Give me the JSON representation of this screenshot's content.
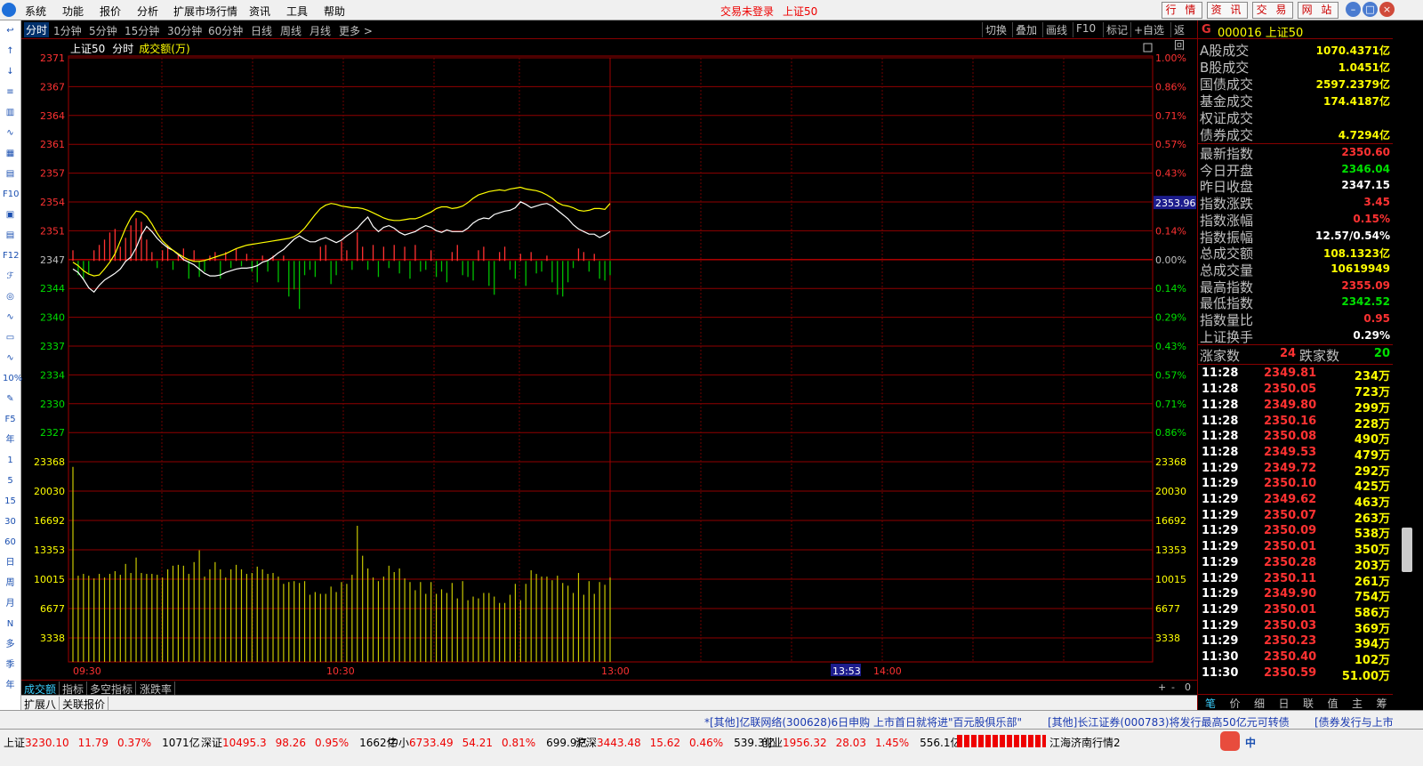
{
  "menu": {
    "items": [
      "系统",
      "功能",
      "报价",
      "分析",
      "扩展市场行情",
      "资讯",
      "工具",
      "帮助"
    ],
    "login_status": "交易未登录",
    "index_name": "上证50"
  },
  "top_buttons": [
    "行 情",
    "资 讯",
    "交 易",
    "网 站"
  ],
  "period_tabs": {
    "items": [
      "分时",
      "1分钟",
      "5分钟",
      "15分钟",
      "30分钟",
      "60分钟",
      "日线",
      "周线",
      "月线",
      "更多 >"
    ],
    "active": "分时"
  },
  "right_tools": [
    "切换",
    "叠加",
    "画线",
    "F10",
    "标记",
    "+自选",
    "返回"
  ],
  "chart_header": {
    "name": "上证50",
    "period": "分时",
    "indicator": "成交额(万)"
  },
  "side_tools": [
    "↩",
    "↑",
    "↓",
    "≡",
    "▥",
    "∿",
    "▦",
    "▤",
    "F10",
    "▣",
    "▤",
    "F12",
    "ℱ",
    "◎",
    "∿",
    "▭",
    "∿",
    "10%",
    "✎",
    "F5",
    "年",
    "1",
    "5",
    "15",
    "30",
    "60",
    "日",
    "周",
    "月",
    "N",
    "多",
    "季",
    "年"
  ],
  "chart_data": [
    {
      "type": "line",
      "title": "上证50 分时",
      "time_labels": [
        "09:30",
        "10:30",
        "13:00",
        "13:53",
        "14:00"
      ],
      "yticks_left": [
        2371,
        2367,
        2364,
        2361,
        2357,
        2354,
        2351,
        2347,
        2344,
        2340,
        2337,
        2334,
        2330,
        2327
      ],
      "yticks_right": [
        "1.00%",
        "0.86%",
        "0.71%",
        "0.57%",
        "0.43%",
        "0.29%",
        "0.14%",
        "0.00%",
        "0.14%",
        "0.29%",
        "0.43%",
        "0.57%",
        "0.71%",
        "0.86%"
      ],
      "prev_close": 2347.15,
      "ylim": [
        2327,
        2371
      ],
      "current_label": "2353.96",
      "series": [
        {
          "name": "price",
          "color": "#ffffff",
          "values": [
            2346.2,
            2345.8,
            2345.0,
            2344.0,
            2343.5,
            2344.3,
            2344.9,
            2345.3,
            2345.7,
            2346.2,
            2347.1,
            2347.6,
            2348.7,
            2350.2,
            2351.2,
            2350.6,
            2349.8,
            2349.2,
            2348.7,
            2348.4,
            2347.9,
            2347.3,
            2347.0,
            2346.7,
            2346.2,
            2345.7,
            2345.4,
            2345.4,
            2345.5,
            2345.8,
            2346.0,
            2346.2,
            2346.3,
            2346.3,
            2346.4,
            2346.6,
            2347.0,
            2347.2,
            2347.6,
            2348.1,
            2348.5,
            2349.1,
            2349.7,
            2350.1,
            2349.7,
            2349.4,
            2349.4,
            2349.7,
            2349.9,
            2349.6,
            2349.3,
            2349.6,
            2350.1,
            2350.5,
            2351.0,
            2351.7,
            2352.3,
            2351.2,
            2350.6,
            2351.1,
            2351.3,
            2351.0,
            2350.5,
            2350.2,
            2350.4,
            2350.6,
            2351.0,
            2351.3,
            2351.1,
            2350.7,
            2350.5,
            2350.8,
            2350.6,
            2350.6,
            2350.6,
            2351.0,
            2351.6,
            2352.0,
            2352.2,
            2352.1,
            2352.6,
            2352.8,
            2353.0,
            2353.1,
            2353.4,
            2354.1,
            2353.8,
            2353.4,
            2353.6,
            2353.8,
            2353.9,
            2353.6,
            2353.1,
            2352.6,
            2352.1,
            2351.4,
            2350.9,
            2350.6,
            2350.3,
            2350.3,
            2349.9,
            2350.2,
            2350.6
          ]
        },
        {
          "name": "average",
          "color": "#ffff00",
          "values": [
            2347.0,
            2346.6,
            2346.0,
            2345.6,
            2345.4,
            2345.5,
            2346.2,
            2347.0,
            2348.0,
            2349.5,
            2351.0,
            2352.2,
            2353.0,
            2352.9,
            2352.4,
            2351.5,
            2350.4,
            2349.5,
            2348.9,
            2348.4,
            2348.0,
            2347.6,
            2347.3,
            2347.1,
            2347.1,
            2347.2,
            2347.4,
            2347.6,
            2347.8,
            2348.0,
            2348.3,
            2348.6,
            2348.8,
            2349.0,
            2349.1,
            2349.2,
            2349.3,
            2349.4,
            2349.5,
            2349.6,
            2349.7,
            2349.8,
            2350.0,
            2350.4,
            2351.0,
            2351.8,
            2352.6,
            2353.3,
            2353.7,
            2353.9,
            2353.8,
            2353.6,
            2353.5,
            2353.4,
            2353.4,
            2353.3,
            2353.1,
            2352.8,
            2352.5,
            2352.2,
            2352.0,
            2351.9,
            2351.9,
            2352.0,
            2352.1,
            2352.1,
            2352.3,
            2352.6,
            2352.9,
            2353.3,
            2353.5,
            2353.5,
            2353.3,
            2353.4,
            2353.6,
            2354.0,
            2354.5,
            2354.9,
            2355.1,
            2355.3,
            2355.4,
            2355.5,
            2355.4,
            2355.6,
            2355.7,
            2355.8,
            2355.6,
            2355.5,
            2355.4,
            2355.2,
            2354.9,
            2354.5,
            2354.0,
            2353.7,
            2353.6,
            2353.4,
            2353.1,
            2353.0,
            2353.1,
            2353.3,
            2353.3,
            2353.2,
            2353.9
          ]
        }
      ],
      "breadth_bars": [
        0.6,
        -0.8,
        -1.0,
        -0.7,
        0.6,
        0.9,
        1.2,
        1.6,
        1.8,
        0.8,
        1.3,
        2.0,
        2.4,
        2.2,
        1.2,
        0.5,
        -0.4,
        0.6,
        0.9,
        -0.5,
        0.4,
        0.7,
        -1.0,
        0.6,
        -0.9,
        -0.6,
        0.3,
        0.5,
        -1.0,
        0.5,
        -0.4,
        0.7,
        -0.3,
        0.4,
        -0.6,
        -1.2,
        0.3,
        -0.6,
        0.3,
        -1.2,
        0.3,
        -2.0,
        -1.6,
        -2.7,
        -0.8,
        -0.5,
        -0.9,
        0.8,
        0.9,
        -1.3,
        -0.8,
        1.1,
        0.6,
        -0.5,
        1.6,
        0.8,
        -0.5,
        0.9,
        -0.9,
        0.8,
        -0.4,
        0.9,
        -0.7,
        0.8,
        -1.0,
        0.9,
        -0.6,
        -0.5,
        0.6,
        -0.9,
        -0.6,
        -1.2,
        0.5,
        0.9,
        -0.8,
        -0.9,
        -1.1,
        0.6,
        0.8,
        -1.4,
        -1.9,
        0.5,
        0.8,
        -0.5,
        -1.0,
        0.4,
        -1.4,
        0.5,
        -0.7,
        -0.6,
        0.3,
        -1.2,
        -1.9,
        -2.0,
        -1.2,
        -0.4,
        0.7,
        0.5,
        -0.6,
        0.4,
        -1.0,
        -1.1,
        -0.8
      ]
    },
    {
      "type": "bar",
      "title": "成交额(万)",
      "yticks": [
        23368,
        20030,
        16692,
        13353,
        10015,
        6677,
        3338
      ],
      "ylim": [
        0,
        25000
      ],
      "color": "#c8c800",
      "values": [
        21500,
        9500,
        9700,
        9500,
        9200,
        9700,
        9300,
        9700,
        10000,
        9600,
        10800,
        9800,
        11500,
        9800,
        9700,
        9700,
        9600,
        9300,
        10200,
        10600,
        10700,
        10600,
        9700,
        11000,
        12300,
        9400,
        10200,
        11000,
        10200,
        9300,
        10200,
        10700,
        10200,
        9700,
        9800,
        10500,
        10200,
        9700,
        9800,
        9400,
        8600,
        8800,
        8900,
        8700,
        8900,
        7400,
        7700,
        7500,
        7500,
        8300,
        7700,
        8800,
        8600,
        9600,
        15000,
        11700,
        10300,
        9300,
        8900,
        9400,
        10600,
        9900,
        10300,
        9200,
        8800,
        7900,
        8800,
        7500,
        8800,
        7500,
        8000,
        7600,
        8700,
        7000,
        8900,
        6800,
        7200,
        7000,
        7600,
        7600,
        7200,
        6500,
        6500,
        7400,
        8600,
        6800,
        8600,
        10100,
        9700,
        9400,
        9400,
        9000,
        9500,
        8700,
        8400,
        7600,
        9800,
        7400,
        8900,
        7500,
        8800,
        8500,
        9300
      ]
    }
  ],
  "panel": {
    "code": "G",
    "title": "000016 上证50",
    "stats": [
      {
        "k": "A股成交",
        "v": "1070.4371亿",
        "c": "#ffff00"
      },
      {
        "k": "B股成交",
        "v": "1.0451亿",
        "c": "#ffff00"
      },
      {
        "k": "国债成交",
        "v": "2597.2379亿",
        "c": "#ffff00"
      },
      {
        "k": "基金成交",
        "v": "174.4187亿",
        "c": "#ffff00"
      },
      {
        "k": "权证成交",
        "v": "",
        "c": "#ffff00"
      },
      {
        "k": "债券成交",
        "v": "4.7294亿",
        "c": "#ffff00"
      }
    ],
    "quotes": [
      {
        "k": "最新指数",
        "v": "2350.60",
        "c": "#ff3232"
      },
      {
        "k": "今日开盘",
        "v": "2346.04",
        "c": "#00e000"
      },
      {
        "k": "昨日收盘",
        "v": "2347.15",
        "c": "#ffffff"
      },
      {
        "k": "指数涨跌",
        "v": "3.45",
        "c": "#ff3232"
      },
      {
        "k": "指数涨幅",
        "v": "0.15%",
        "c": "#ff3232"
      },
      {
        "k": "指数振幅",
        "v": "12.57/0.54%",
        "c": "#ffffff"
      },
      {
        "k": "总成交额",
        "v": "108.1323亿",
        "c": "#ffff00"
      },
      {
        "k": "总成交量",
        "v": "10619949",
        "c": "#ffff00"
      },
      {
        "k": "最高指数",
        "v": "2355.09",
        "c": "#ff3232"
      },
      {
        "k": "最低指数",
        "v": "2342.52",
        "c": "#00e000"
      },
      {
        "k": "指数量比",
        "v": "0.95",
        "c": "#ff3232"
      },
      {
        "k": "上证换手",
        "v": "0.29%",
        "c": "#ffffff"
      }
    ],
    "breadth": {
      "up_label": "涨家数",
      "up": "24",
      "down_label": "跌家数",
      "down": "20"
    },
    "ticks": [
      {
        "t": "11:28",
        "p": "2349.81",
        "v": "234万"
      },
      {
        "t": "11:28",
        "p": "2350.05",
        "v": "723万"
      },
      {
        "t": "11:28",
        "p": "2349.80",
        "v": "299万"
      },
      {
        "t": "11:28",
        "p": "2350.16",
        "v": "228万"
      },
      {
        "t": "11:28",
        "p": "2350.08",
        "v": "490万"
      },
      {
        "t": "11:28",
        "p": "2349.53",
        "v": "479万"
      },
      {
        "t": "11:29",
        "p": "2349.72",
        "v": "292万"
      },
      {
        "t": "11:29",
        "p": "2350.10",
        "v": "425万"
      },
      {
        "t": "11:29",
        "p": "2349.62",
        "v": "463万"
      },
      {
        "t": "11:29",
        "p": "2350.07",
        "v": "263万"
      },
      {
        "t": "11:29",
        "p": "2350.09",
        "v": "538万"
      },
      {
        "t": "11:29",
        "p": "2350.01",
        "v": "350万"
      },
      {
        "t": "11:29",
        "p": "2350.28",
        "v": "203万"
      },
      {
        "t": "11:29",
        "p": "2350.11",
        "v": "261万"
      },
      {
        "t": "11:29",
        "p": "2349.90",
        "v": "754万"
      },
      {
        "t": "11:29",
        "p": "2350.01",
        "v": "586万"
      },
      {
        "t": "11:29",
        "p": "2350.03",
        "v": "369万"
      },
      {
        "t": "11:29",
        "p": "2350.23",
        "v": "394万"
      },
      {
        "t": "11:30",
        "p": "2350.40",
        "v": "102万"
      },
      {
        "t": "11:30",
        "p": "2350.59",
        "v": "51.00万"
      }
    ],
    "tabs": [
      "笔",
      "价",
      "细",
      "日",
      "联",
      "值",
      "主",
      "筹"
    ],
    "active_tab": "笔"
  },
  "bottom_tabs": {
    "items": [
      "成交额",
      "指标",
      "多空指标",
      "涨跌率"
    ],
    "active": "成交额",
    "controls": [
      "+",
      "-",
      "0"
    ]
  },
  "ext_tabs": [
    "扩展八",
    "关联报价"
  ],
  "news": [
    "*[其他]亿联网络(300628)6日申购 上市首日就将进\"百元股俱乐部\"",
    "[其他]长江证券(000783)将发行最高50亿元可转债",
    "[债券发行与上市"
  ],
  "status": {
    "items": [
      {
        "name": "上证",
        "val": "3230.10",
        "chg": "11.79",
        "pct": "0.37%",
        "amt": "1071亿"
      },
      {
        "name": "深证",
        "val": "10495.3",
        "chg": "98.26",
        "pct": "0.95%",
        "amt": "1662亿"
      },
      {
        "name": "中小",
        "val": "6733.49",
        "chg": "54.21",
        "pct": "0.81%",
        "amt": "699.9亿"
      },
      {
        "name": "沪深",
        "val": "3443.48",
        "chg": "15.62",
        "pct": "0.46%",
        "amt": "539.3亿"
      },
      {
        "name": "创业",
        "val": "1956.32",
        "chg": "28.03",
        "pct": "1.45%",
        "amt": "556.1亿"
      }
    ],
    "server": "江海济南行情2",
    "ime": "中"
  }
}
